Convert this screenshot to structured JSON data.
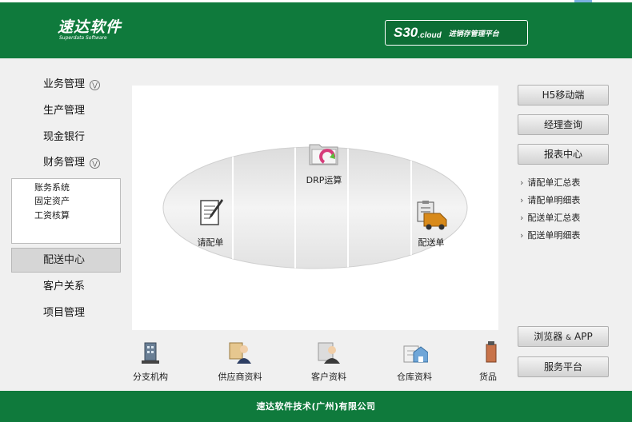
{
  "header": {
    "logo_main": "速达软件",
    "logo_sub": "Superdata Software",
    "product_code": "S30",
    "product_cloud": ".cloud",
    "product_tagline": "进销存管理平台"
  },
  "nav": {
    "items": [
      {
        "label": "业务管理",
        "expandable": true
      },
      {
        "label": "生产管理"
      },
      {
        "label": "现金银行"
      },
      {
        "label": "财务管理",
        "expandable": true
      }
    ],
    "expand_icon": "chevron-double-down-icon",
    "finance_sub": [
      "账务系统",
      "固定资产",
      "工资核算"
    ],
    "active_item": "配送中心",
    "bottom_items": [
      "客户关系",
      "项目管理"
    ]
  },
  "flow": {
    "top": {
      "label": "DRP运算",
      "icon": "folder-refresh-icon"
    },
    "left": {
      "label": "请配单",
      "icon": "clipboard-edit-icon"
    },
    "right": {
      "label": "配送单",
      "icon": "delivery-truck-icon"
    }
  },
  "right_panel": {
    "buttons": [
      "H5移动端",
      "经理查询",
      "报表中心"
    ],
    "reports": [
      "请配单汇总表",
      "请配单明细表",
      "配送单汇总表",
      "配送单明细表"
    ],
    "browser_app_main": "浏览器",
    "browser_app_amp": "&",
    "browser_app_tail": "APP",
    "service": "服务平台"
  },
  "quick_links": [
    {
      "label": "分支机构",
      "icon": "building-icon"
    },
    {
      "label": "供应商资料",
      "icon": "supplier-icon"
    },
    {
      "label": "客户资料",
      "icon": "customer-icon"
    },
    {
      "label": "仓库资料",
      "icon": "warehouse-icon"
    },
    {
      "label": "货品",
      "icon": "goods-icon"
    }
  ],
  "footer": {
    "text": "速达软件技术(广州)有限公司"
  },
  "colors": {
    "brand_green": "#0f7a3c",
    "panel_bg": "#f0f0f0"
  }
}
